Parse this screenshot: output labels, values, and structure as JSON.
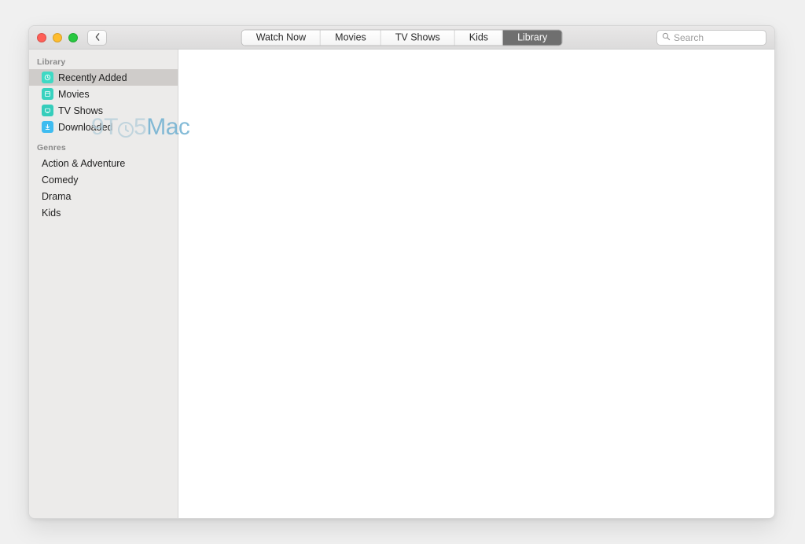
{
  "tabs": {
    "watch_now": "Watch Now",
    "movies": "Movies",
    "tv_shows": "TV Shows",
    "kids": "Kids",
    "library": "Library"
  },
  "search": {
    "placeholder": "Search",
    "value": ""
  },
  "sidebar": {
    "library_header": "Library",
    "library_items": {
      "recently_added": "Recently Added",
      "movies": "Movies",
      "tv_shows": "TV Shows",
      "downloaded": "Downloaded"
    },
    "genres_header": "Genres",
    "genres": {
      "action": "Action & Adventure",
      "comedy": "Comedy",
      "drama": "Drama",
      "kids": "Kids"
    }
  },
  "watermark": {
    "prefix": "9T",
    "suffix_light": "5",
    "suffix_color": "Mac"
  }
}
